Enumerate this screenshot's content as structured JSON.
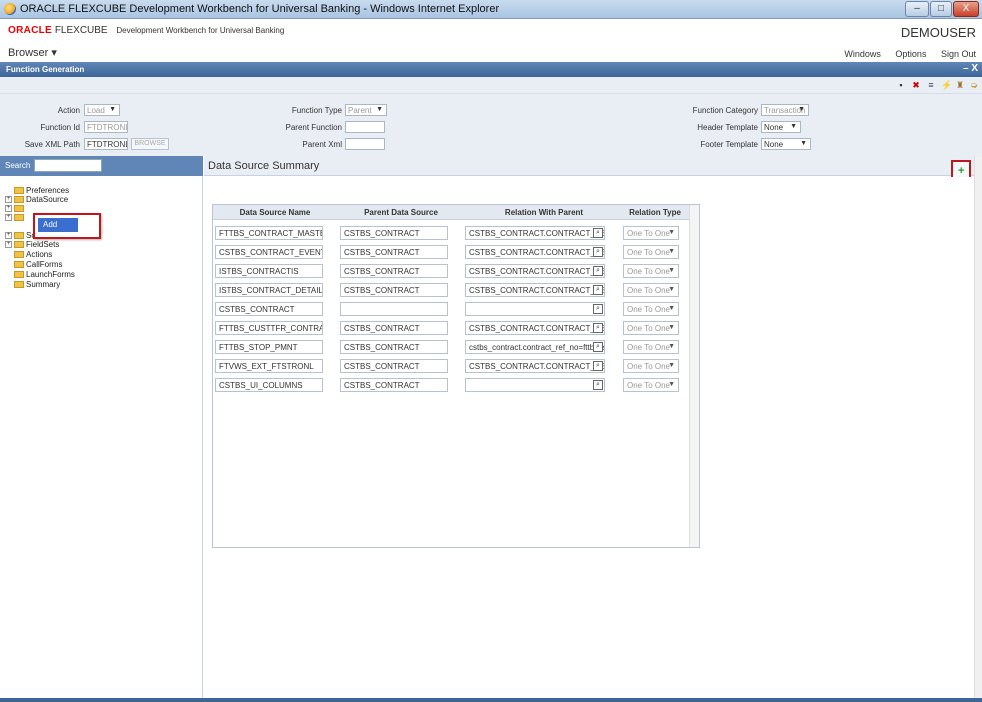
{
  "window": {
    "title": "ORACLE FLEXCUBE Development Workbench for Universal Banking - Windows Internet Explorer",
    "minimize": "–",
    "maximize": "□",
    "close": "X"
  },
  "header": {
    "brand_oracle": "ORACLE",
    "brand_product": "FLEXCUBE",
    "brand_sub": "Development Workbench for Universal Banking",
    "browser_menu": "Browser ▾",
    "user": "DEMOUSER",
    "nav": [
      "Windows",
      "Options",
      "Sign Out"
    ]
  },
  "function_bar": {
    "title": "Function Generation",
    "minimize": "– X"
  },
  "toolbar": {
    "icons": [
      "save-icon",
      "delete-icon",
      "list-icon",
      "generate-icon",
      "deploy-icon",
      "exit-icon"
    ],
    "glyphs": [
      "▪",
      "✖",
      "≡",
      "⚡",
      "♜",
      "➭"
    ]
  },
  "form": {
    "action_label": "Action",
    "action_value": "Load",
    "function_id_label": "Function Id",
    "function_id_value": "FTDTRONL",
    "save_xml_label": "Save XML Path",
    "save_xml_value": "FTDTRONL_R",
    "browse": "BROWSE",
    "function_type_label": "Function Type",
    "function_type_value": "Parent",
    "parent_function_label": "Parent Function",
    "parent_function_value": "",
    "parent_xml_label": "Parent Xml",
    "parent_xml_value": "",
    "function_category_label": "Function Category",
    "function_category_value": "Transaction",
    "header_template_label": "Header Template",
    "header_template_value": "None",
    "footer_template_label": "Footer Template",
    "footer_template_value": "None"
  },
  "left": {
    "search_label": "Search",
    "tree": [
      {
        "label": "Preferences",
        "expandable": false
      },
      {
        "label": "DataSource",
        "expandable": true
      },
      {
        "label": "",
        "expandable": true
      },
      {
        "label": "",
        "expandable": true
      },
      {
        "label": "Screens",
        "expandable": true
      },
      {
        "label": "FieldSets",
        "expandable": true
      },
      {
        "label": "Actions",
        "expandable": false
      },
      {
        "label": "CallForms",
        "expandable": false
      },
      {
        "label": "LaunchForms",
        "expandable": false
      },
      {
        "label": "Summary",
        "expandable": false
      }
    ],
    "context_menu": {
      "add": "Add"
    }
  },
  "right": {
    "title": "Data Source Summary",
    "add_glyph": "+",
    "columns": [
      "Data Source Name",
      "Parent Data Source",
      "Relation With Parent",
      "Relation Type"
    ],
    "rows": [
      {
        "name": "FTTBS_CONTRACT_MASTER",
        "parent": "CSTBS_CONTRACT",
        "relation": "CSTBS_CONTRACT.CONTRACT_REF_NO=",
        "type": "One To One"
      },
      {
        "name": "CSTBS_CONTRACT_EVENT_LOG",
        "parent": "CSTBS_CONTRACT",
        "relation": "CSTBS_CONTRACT.CONTRACT_REF_NO=",
        "type": "One To One"
      },
      {
        "name": "ISTBS_CONTRACTIS",
        "parent": "CSTBS_CONTRACT",
        "relation": "CSTBS_CONTRACT.CONTRACT_REF_NO=",
        "type": "One To One"
      },
      {
        "name": "ISTBS_CONTRACT_DETAILS",
        "parent": "CSTBS_CONTRACT",
        "relation": "CSTBS_CONTRACT.CONTRACT_REF_NO",
        "type": "One To One"
      },
      {
        "name": "CSTBS_CONTRACT",
        "parent": "",
        "relation": "",
        "type": "One To One"
      },
      {
        "name": "FTTBS_CUSTTFR_CONTRACT_DTL",
        "parent": "CSTBS_CONTRACT",
        "relation": "CSTBS_CONTRACT.CONTRACT_REF_NO=",
        "type": "One To One"
      },
      {
        "name": "FTTBS_STOP_PMNT",
        "parent": "CSTBS_CONTRACT",
        "relation": "cstbs_contract.contract_ref_no=fttbs_stop_p",
        "type": "One To One"
      },
      {
        "name": "FTVWS_EXT_FTSTRONL",
        "parent": "CSTBS_CONTRACT",
        "relation": "CSTBS_CONTRACT.CONTRACT_REF_NO=",
        "type": "One To One"
      },
      {
        "name": "CSTBS_UI_COLUMNS",
        "parent": "CSTBS_CONTRACT",
        "relation": "",
        "type": "One To One"
      }
    ]
  }
}
